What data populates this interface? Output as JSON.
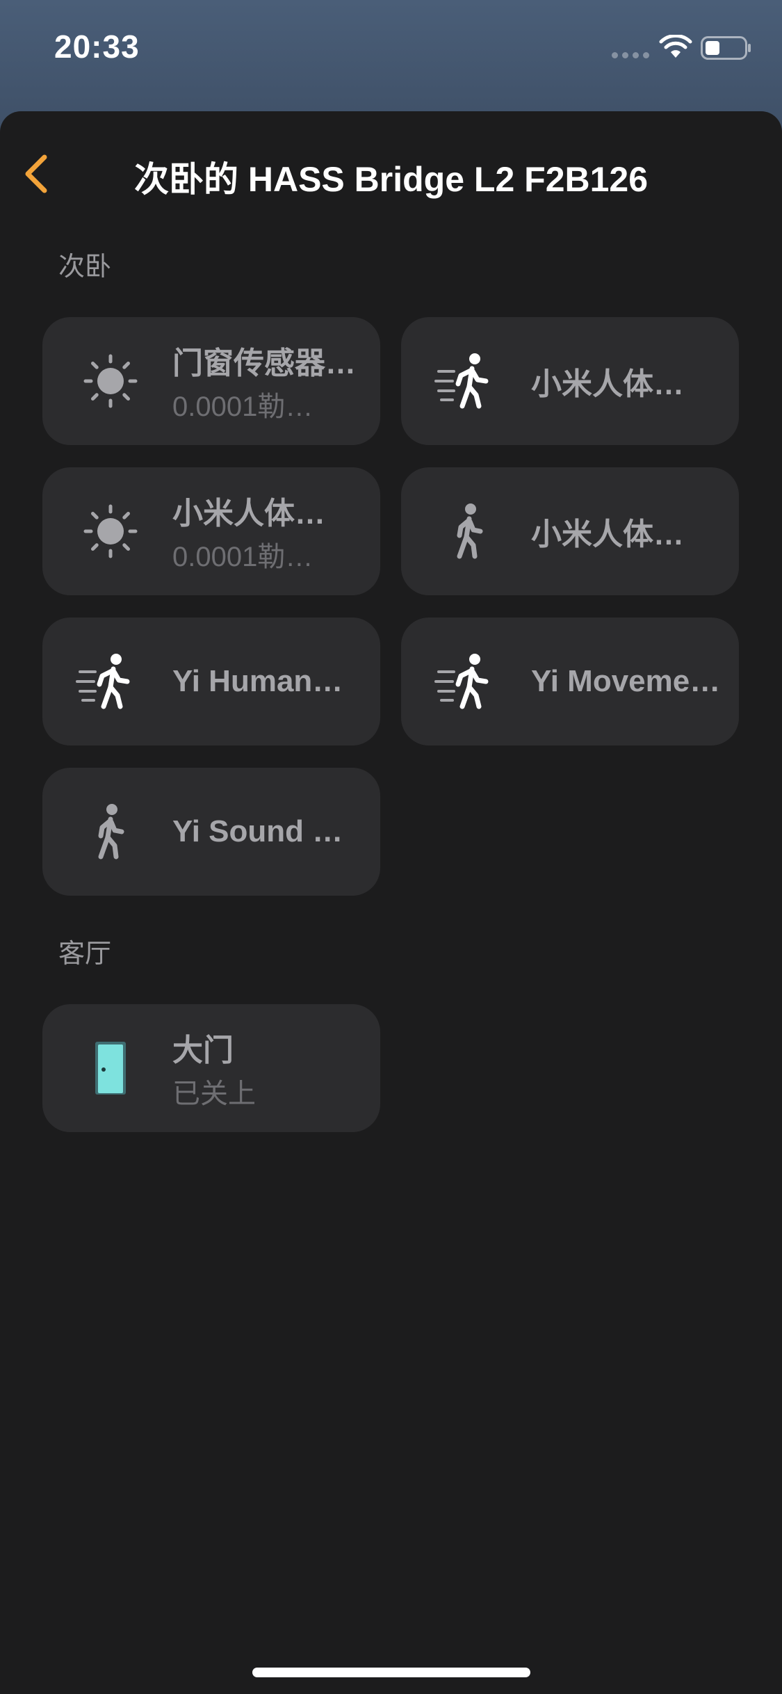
{
  "status_bar": {
    "time": "20:33"
  },
  "nav": {
    "title": "次卧的 HASS Bridge L2 F2B126",
    "accent_color": "#f2a33a"
  },
  "sections": [
    {
      "title": "次卧",
      "tiles": [
        {
          "icon": "sun-icon",
          "name": "门窗传感器…",
          "sub": "0.0001勒…"
        },
        {
          "icon": "motion-running-icon",
          "name": "小米人体…",
          "sub": ""
        },
        {
          "icon": "sun-icon",
          "name": "小米人体…",
          "sub": "0.0001勒…"
        },
        {
          "icon": "walking-person-icon",
          "name": "小米人体…",
          "sub": ""
        },
        {
          "icon": "motion-running-icon",
          "name": "Yi Human…",
          "sub": ""
        },
        {
          "icon": "motion-running-icon",
          "name": "Yi Moveme…",
          "sub": ""
        },
        {
          "icon": "walking-person-icon",
          "name": "Yi Sound D…",
          "sub": ""
        }
      ]
    },
    {
      "title": "客厅",
      "tiles": [
        {
          "icon": "door-icon",
          "name": "大门",
          "sub": "已关上"
        }
      ]
    }
  ]
}
